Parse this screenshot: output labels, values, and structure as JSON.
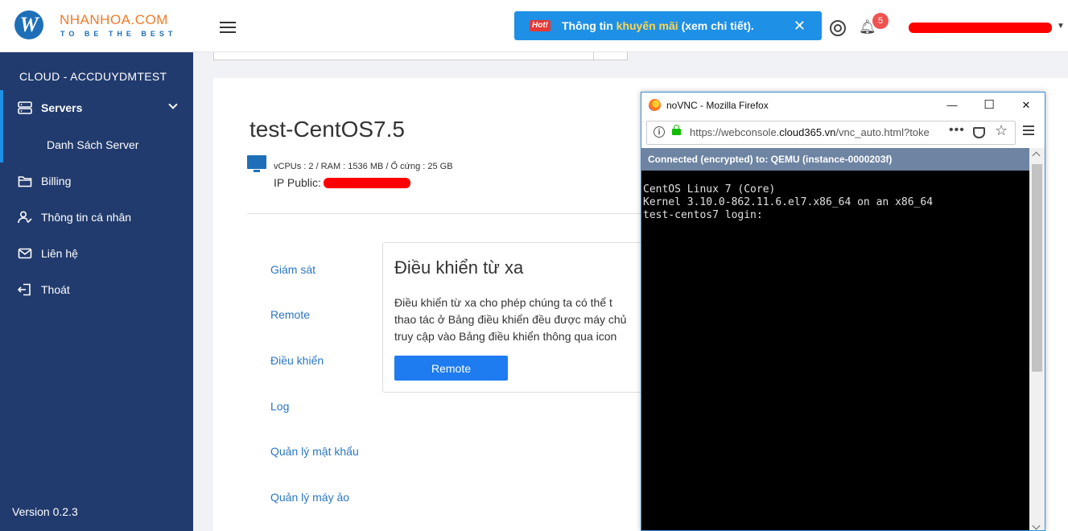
{
  "header": {
    "brand_name": "NHANHOA.COM",
    "brand_slogan": "TO BE THE BEST",
    "logo_letter": "W",
    "promo": {
      "hot_label": "Hot!",
      "text_before": "Thông tin ",
      "text_highlight": "khuyến mãi",
      "text_after": " (xem chi tiết).",
      "close": "✕"
    },
    "notification_count": "5",
    "icons": [
      "menu-icon",
      "lifebuoy-icon",
      "bell-icon",
      "chevron-down-icon"
    ]
  },
  "sidebar": {
    "title": "CLOUD - ACCDUYDMTEST",
    "items": [
      {
        "label": "Servers",
        "icon": "server-icon",
        "active": true,
        "expanded": true
      },
      {
        "label": "Billing",
        "icon": "folder-icon"
      },
      {
        "label": "Thông tin cá nhân",
        "icon": "user-icon"
      },
      {
        "label": "Liên hệ",
        "icon": "mail-icon"
      },
      {
        "label": "Thoát",
        "icon": "logout-icon"
      }
    ],
    "sub_items": [
      {
        "label": "Danh Sách Server"
      }
    ],
    "version": "Version 0.2.3"
  },
  "server": {
    "name": "test-CentOS7.5",
    "spec": "vCPUs : 2 / RAM : 1536 MB / Ổ cứng : 25 GB",
    "ip_label": "IP Public:"
  },
  "tabs": [
    {
      "label": "Giám sát"
    },
    {
      "label": "Remote"
    },
    {
      "label": "Điều khiển"
    },
    {
      "label": "Log"
    },
    {
      "label": "Quản lý mật khẩu"
    },
    {
      "label": "Quản lý máy ảo"
    }
  ],
  "remote_panel": {
    "title": "Điều khiển từ xa",
    "desc_lines": [
      "   Điều khiển từ xa cho phép chúng ta có thể t",
      "thao tác ở Bảng điều khiển đều được máy chủ",
      "truy cập vào Bảng điều khiển thông qua icon"
    ],
    "button": "Remote"
  },
  "browser": {
    "window_title": "noVNC - Mozilla Firefox",
    "url_prefix": "https://webconsole.",
    "url_domain": "cloud365.vn",
    "url_suffix": "/vnc_auto.html?toke",
    "info_glyph": "i",
    "dots": "•••",
    "star": "☆",
    "minimize": "—",
    "maximize": "☐",
    "close": "✕",
    "vnc_status": "Connected (encrypted) to: QEMU (instance-0000203f)",
    "terminal_lines": [
      "CentOS Linux 7 (Core)",
      "Kernel 3.10.0-862.11.6.el7.x86_64 on an x86_64",
      "",
      "test-centos7 login:"
    ]
  },
  "colors": {
    "sidebar_bg": "#223b6e",
    "accent": "#1e90e6",
    "link": "#2a76c6",
    "redaction": "#ff0000"
  }
}
